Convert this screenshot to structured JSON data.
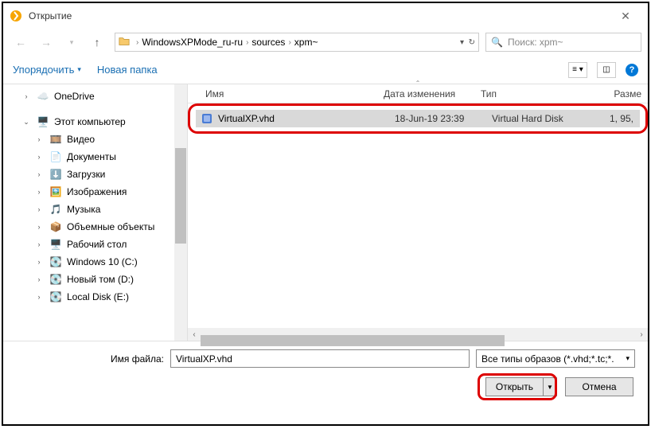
{
  "window": {
    "title": "Открытие"
  },
  "breadcrumbs": {
    "a": "WindowsXPMode_ru-ru",
    "b": "sources",
    "c": "xpm~"
  },
  "search": {
    "placeholder": "Поиск: xpm~"
  },
  "toolbar": {
    "organize": "Упорядочить",
    "newfolder": "Новая папка"
  },
  "columns": {
    "name": "Имя",
    "date": "Дата изменения",
    "type": "Тип",
    "size": "Разме"
  },
  "tree": {
    "onedrive": "OneDrive",
    "thispc": "Этот компьютер",
    "video": "Видео",
    "documents": "Документы",
    "downloads": "Загрузки",
    "images": "Изображения",
    "music": "Музыка",
    "objects3d": "Объемные объекты",
    "desktop": "Рабочий стол",
    "drivec": "Windows 10 (C:)",
    "drived": "Новый том (D:)",
    "drivee": "Local Disk (E:)"
  },
  "file": {
    "name": "VirtualXP.vhd",
    "date": "18-Jun-19 23:39",
    "type": "Virtual Hard Disk",
    "size": "1,   95,"
  },
  "footer": {
    "label": "Имя файла:",
    "value": "VirtualXP.vhd",
    "filter": "Все типы образов (*.vhd;*.tc;*.",
    "open": "Открыть",
    "cancel": "Отмена"
  }
}
